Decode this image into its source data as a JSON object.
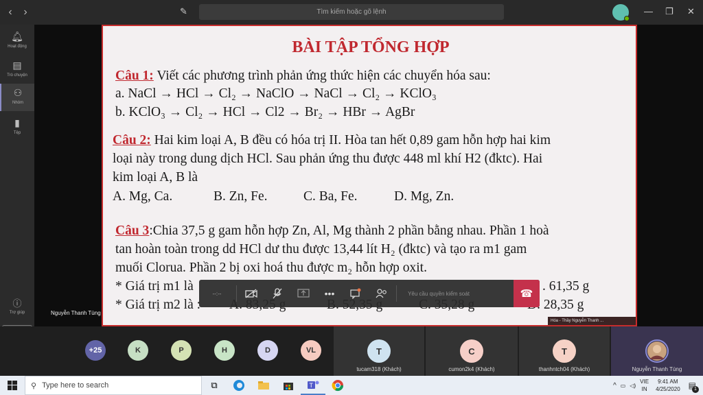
{
  "titlebar": {
    "back": "‹",
    "forward": "›",
    "search_placeholder": "Tìm kiếm hoặc gõ lệnh",
    "minimize": "—",
    "maximize": "❐",
    "close": "✕"
  },
  "rail": {
    "items": [
      {
        "label": "Hoạt động",
        "icon": "bell-icon"
      },
      {
        "label": "Trò chuyện",
        "icon": "chat-icon"
      },
      {
        "label": "Nhóm",
        "icon": "teams-icon"
      },
      {
        "label": "Tệp",
        "icon": "file-icon"
      }
    ],
    "help_label": "Trợ giúp"
  },
  "slide": {
    "title": "BÀI TẬP TỔNG HỢP",
    "q1_label": "Câu 1:",
    "q1_text": " Viết các phương trình phản ứng thức hiện các chuyển hóa sau:",
    "q1_a": "a. NaCl → HCl → Cl₂ → NaClO → NaCl → Cl₂ →  KClO₃",
    "q1_b": "b. KClO₃ → Cl₂ → HCl → Cl2 → Br₂ → HBr → AgBr",
    "q2_label": "Câu 2:",
    "q2_text1": "Hai kim loại A, B đều có hóa trị II. Hòa tan hết 0,89 gam hỗn hợp hai kim",
    "q2_text2": "loại này trong dung dịch HCl. Sau phản ứng thu được 448 ml khí H2 (đktc). Hai",
    "q2_text3": "kim loại A, B là",
    "q2_opt_a": "A. Mg, Ca.",
    "q2_opt_b": "B. Zn, Fe.",
    "q2_opt_c": "C. Ba, Fe.",
    "q2_opt_d": "D. Mg, Zn.",
    "q3_label": "Câu 3",
    "q3_text1": ":Chia 37,5 g gam hỗn hợp Zn, Al, Mg thành 2 phần bằng nhau. Phần 1 hoà",
    "q3_text2": "tan hoàn toàn trong dd HCl dư thu được 13,44 lít H₂ (đktc) và tạo ra m1 gam",
    "q3_text3": "muối Clorua. Phần 2 bị oxi hoá thu được m₂ hỗn hợp oxit.",
    "q3_m1": "* Giá trị m1 là",
    "q3_m1_d": ". 61,35 g",
    "q3_m2": "* Giá trị m2 là :",
    "q3_m2_a": "A. 83,25 g",
    "q3_m2_b": "B. 52,35 g",
    "q3_m2_c": "C. 35,28 g",
    "q3_m2_d": "D. 28,35 g",
    "footer": "Hóa - Thầy Nguyễn Thanh ..."
  },
  "presenter_name": "Nguyễn Thanh Tùng",
  "toolbar": {
    "timer": "--:--",
    "request_control": "Yêu cầu quyền kiểm soát"
  },
  "participants": {
    "overflow": "+25",
    "bubbles": [
      {
        "initial": "K",
        "color": "#c6dfc4"
      },
      {
        "initial": "P",
        "color": "#d4e2b4"
      },
      {
        "initial": "H",
        "color": "#c8e4c6"
      },
      {
        "initial": "D",
        "color": "#d6d6f2"
      },
      {
        "initial": "VL",
        "color": "#f6cbc0"
      }
    ],
    "tiles": [
      {
        "initial": "T",
        "name": "tucam318 (Khách)",
        "color": "#cfe3f0"
      },
      {
        "initial": "C",
        "name": "cumon2k4 (Khách)",
        "color": "#f6cfc8"
      },
      {
        "initial": "T",
        "name": "thanhntch04 (Khách)",
        "color": "#f6d2c6"
      },
      {
        "initial": "",
        "name": "Nguyễn Thanh Tùng",
        "color": "#5a4a8a"
      }
    ]
  },
  "taskbar": {
    "search_placeholder": "Type here to search",
    "lang_line1": "VIE",
    "lang_line2": "IN",
    "time": "9:41 AM",
    "date": "4/25/2020",
    "notification_count": "1"
  },
  "colors": {
    "accent": "#6264a7",
    "hangup": "#c4314b",
    "slide_red": "#c0282f"
  }
}
